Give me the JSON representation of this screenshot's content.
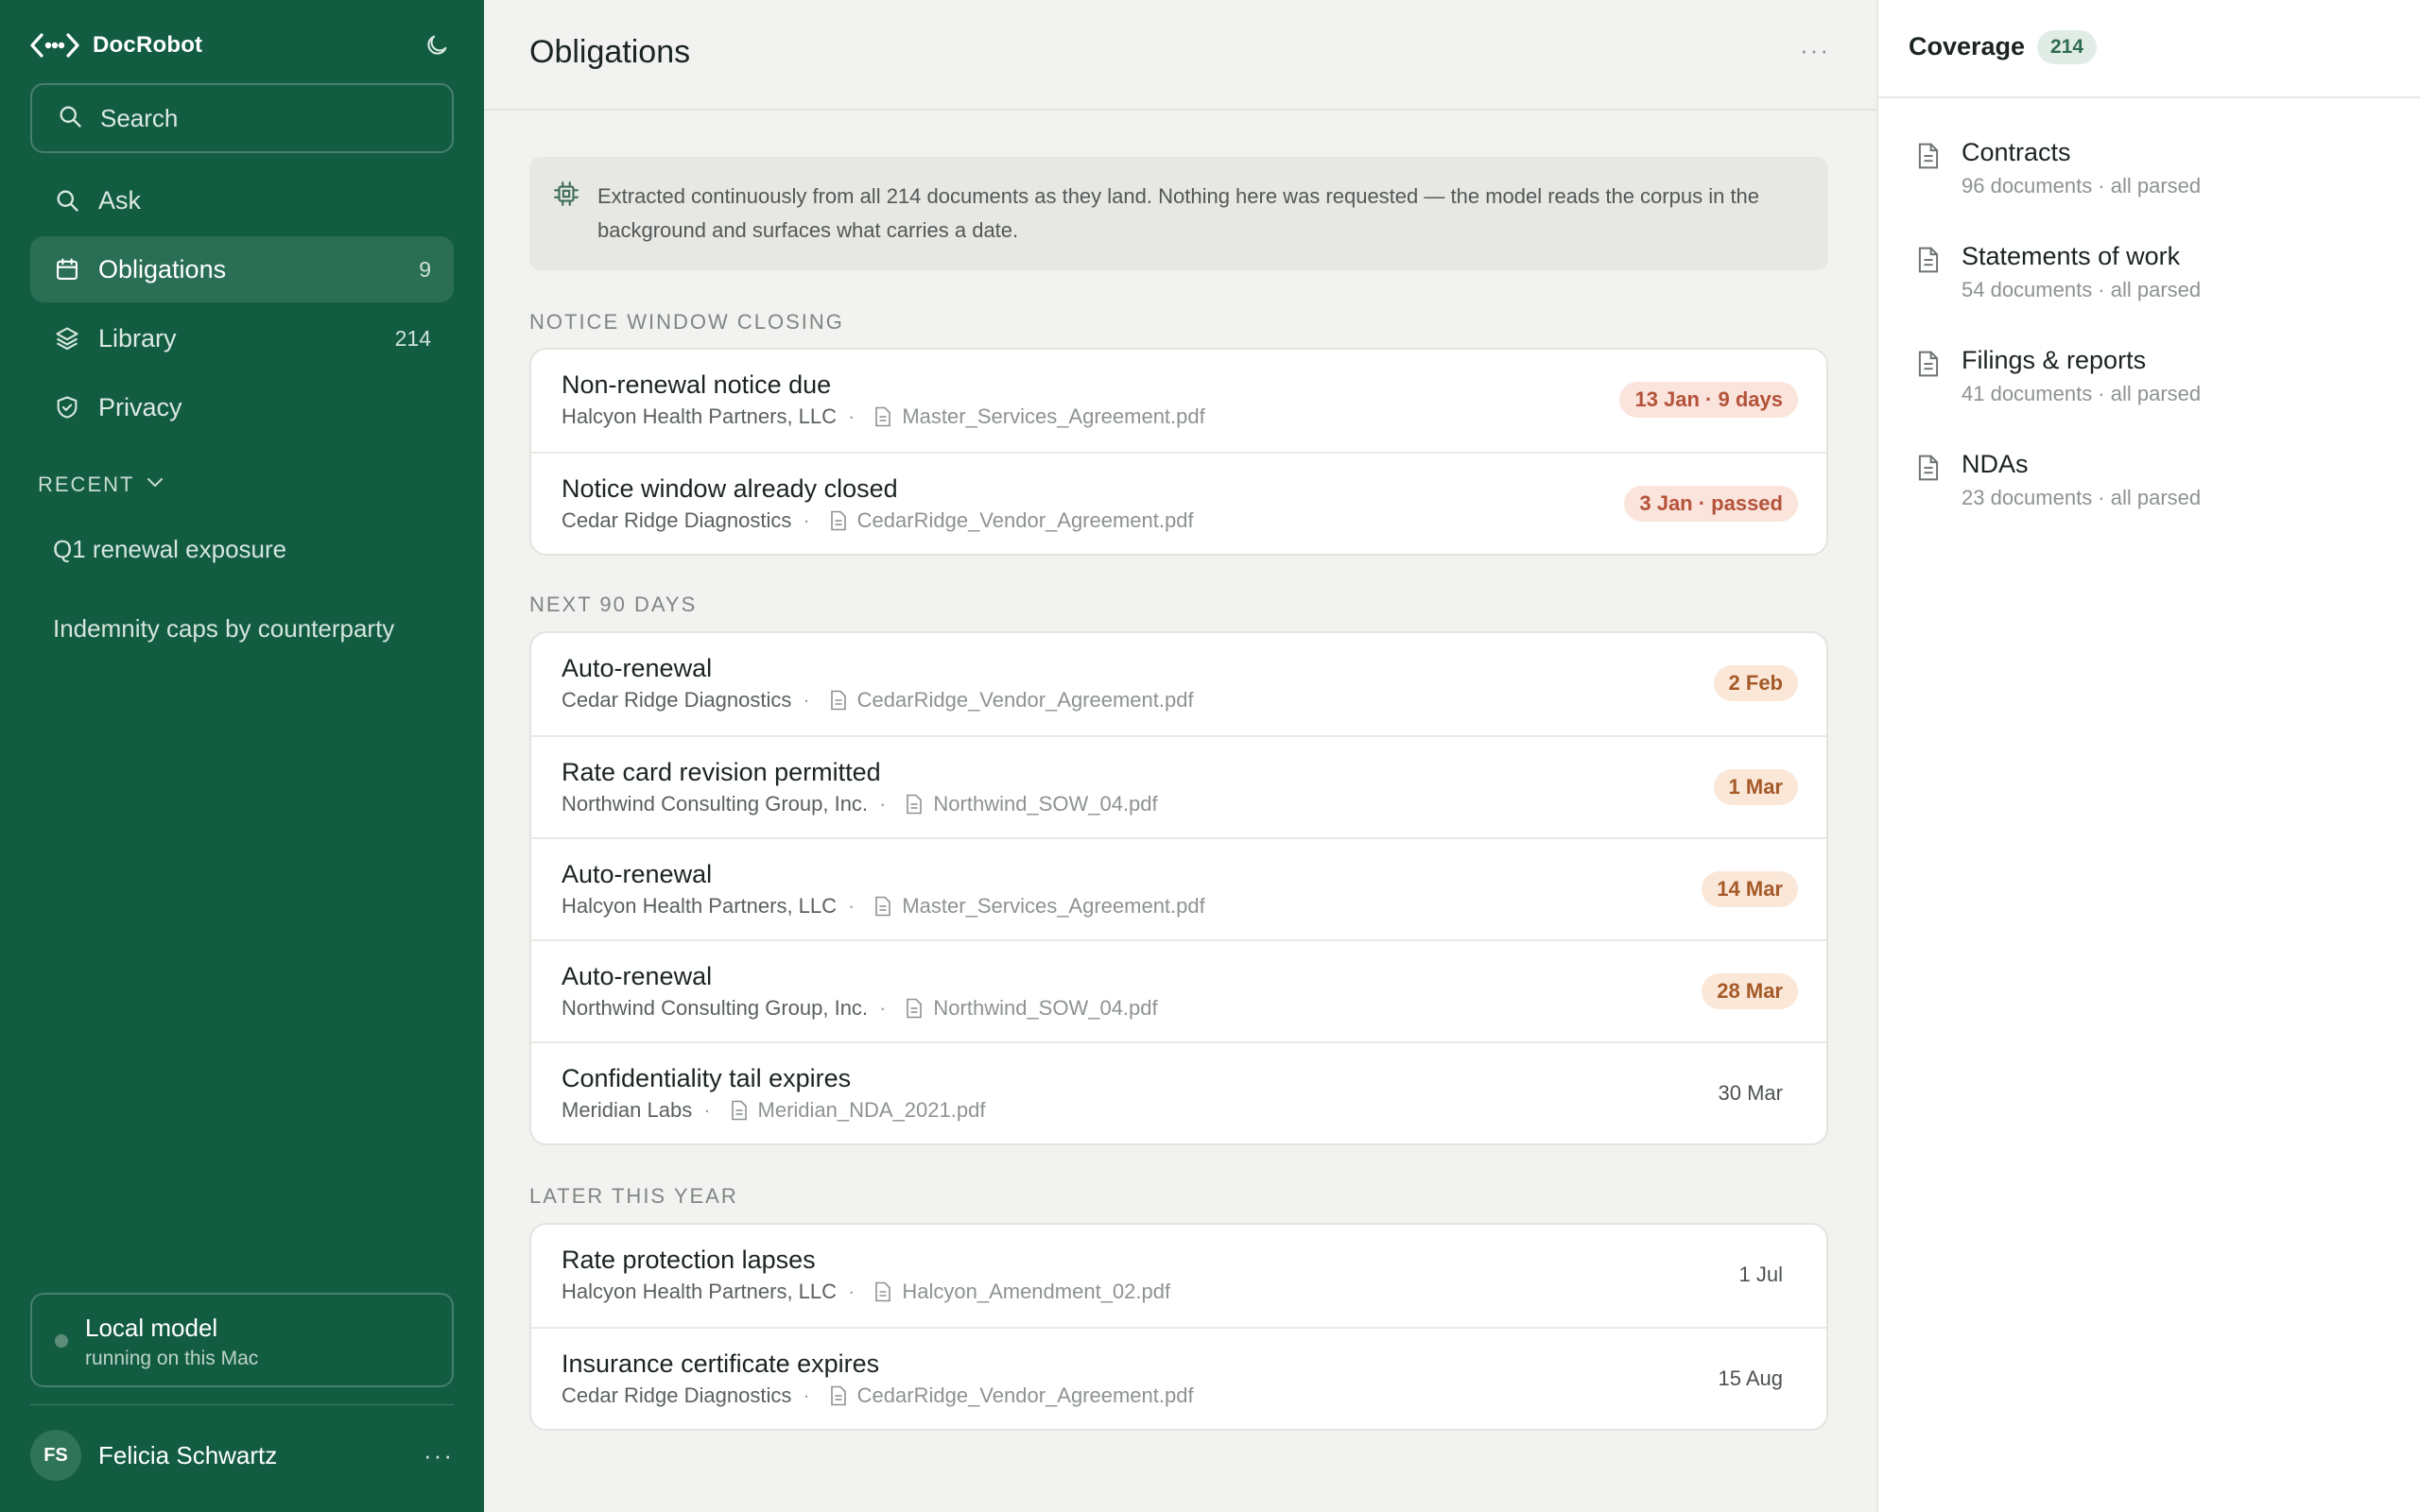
{
  "app": {
    "name": "DocRobot"
  },
  "colors": {
    "sidebar": "#125c42",
    "sidebar_active": "#2a6f55",
    "urgent_pill_bg": "#fbe4dc",
    "urgent_pill_text": "#b4523a",
    "soon_pill_bg": "#fbe7d8",
    "soon_pill_text": "#a55a28"
  },
  "sidebar": {
    "search_placeholder": "Search",
    "nav": [
      {
        "label": "Ask",
        "count": "",
        "icon": "search-icon"
      },
      {
        "label": "Obligations",
        "count": "9",
        "icon": "calendar-icon",
        "active": true
      },
      {
        "label": "Library",
        "count": "214",
        "icon": "layers-icon"
      },
      {
        "label": "Privacy",
        "count": "",
        "icon": "shield-icon"
      }
    ],
    "recent_label": "RECENT",
    "recent": [
      "Q1 renewal exposure",
      "Indemnity caps by counterparty"
    ],
    "local_model": {
      "title": "Local model",
      "subtitle": "running on this Mac"
    },
    "user": {
      "initials": "FS",
      "name": "Felicia Schwartz",
      "more": "···"
    }
  },
  "main": {
    "title": "Obligations",
    "more": "···",
    "banner": "Extracted continuously from all 214 documents as they land. Nothing here was requested — the model reads the corpus in the background and surfaces what carries a date.",
    "sections": [
      {
        "label": "NOTICE WINDOW CLOSING",
        "rows": [
          {
            "title": "Non-renewal notice due",
            "party": "Halcyon Health Partners, LLC",
            "file": "Master_Services_Agreement.pdf",
            "date": "13 Jan · 9 days",
            "tone": "urgent"
          },
          {
            "title": "Notice window already closed",
            "party": "Cedar Ridge Diagnostics",
            "file": "CedarRidge_Vendor_Agreement.pdf",
            "date": "3 Jan · passed",
            "tone": "urgent"
          }
        ]
      },
      {
        "label": "NEXT 90 DAYS",
        "rows": [
          {
            "title": "Auto-renewal",
            "party": "Cedar Ridge Diagnostics",
            "file": "CedarRidge_Vendor_Agreement.pdf",
            "date": "2 Feb",
            "tone": "soon"
          },
          {
            "title": "Rate card revision permitted",
            "party": "Northwind Consulting Group, Inc.",
            "file": "Northwind_SOW_04.pdf",
            "date": "1 Mar",
            "tone": "soon"
          },
          {
            "title": "Auto-renewal",
            "party": "Halcyon Health Partners, LLC",
            "file": "Master_Services_Agreement.pdf",
            "date": "14 Mar",
            "tone": "soon"
          },
          {
            "title": "Auto-renewal",
            "party": "Northwind Consulting Group, Inc.",
            "file": "Northwind_SOW_04.pdf",
            "date": "28 Mar",
            "tone": "soon"
          },
          {
            "title": "Confidentiality tail expires",
            "party": "Meridian Labs",
            "file": "Meridian_NDA_2021.pdf",
            "date": "30 Mar",
            "tone": "plain"
          }
        ]
      },
      {
        "label": "LATER THIS YEAR",
        "rows": [
          {
            "title": "Rate protection lapses",
            "party": "Halcyon Health Partners, LLC",
            "file": "Halcyon_Amendment_02.pdf",
            "date": "1 Jul",
            "tone": "plain"
          },
          {
            "title": "Insurance certificate expires",
            "party": "Cedar Ridge Diagnostics",
            "file": "CedarRidge_Vendor_Agreement.pdf",
            "date": "15 Aug",
            "tone": "plain"
          }
        ]
      }
    ]
  },
  "coverage": {
    "title": "Coverage",
    "count": "214",
    "items": [
      {
        "name": "Contracts",
        "detail": "96 documents · all parsed"
      },
      {
        "name": "Statements of work",
        "detail": "54 documents · all parsed"
      },
      {
        "name": "Filings & reports",
        "detail": "41 documents · all parsed"
      },
      {
        "name": "NDAs",
        "detail": "23 documents · all parsed"
      }
    ]
  }
}
